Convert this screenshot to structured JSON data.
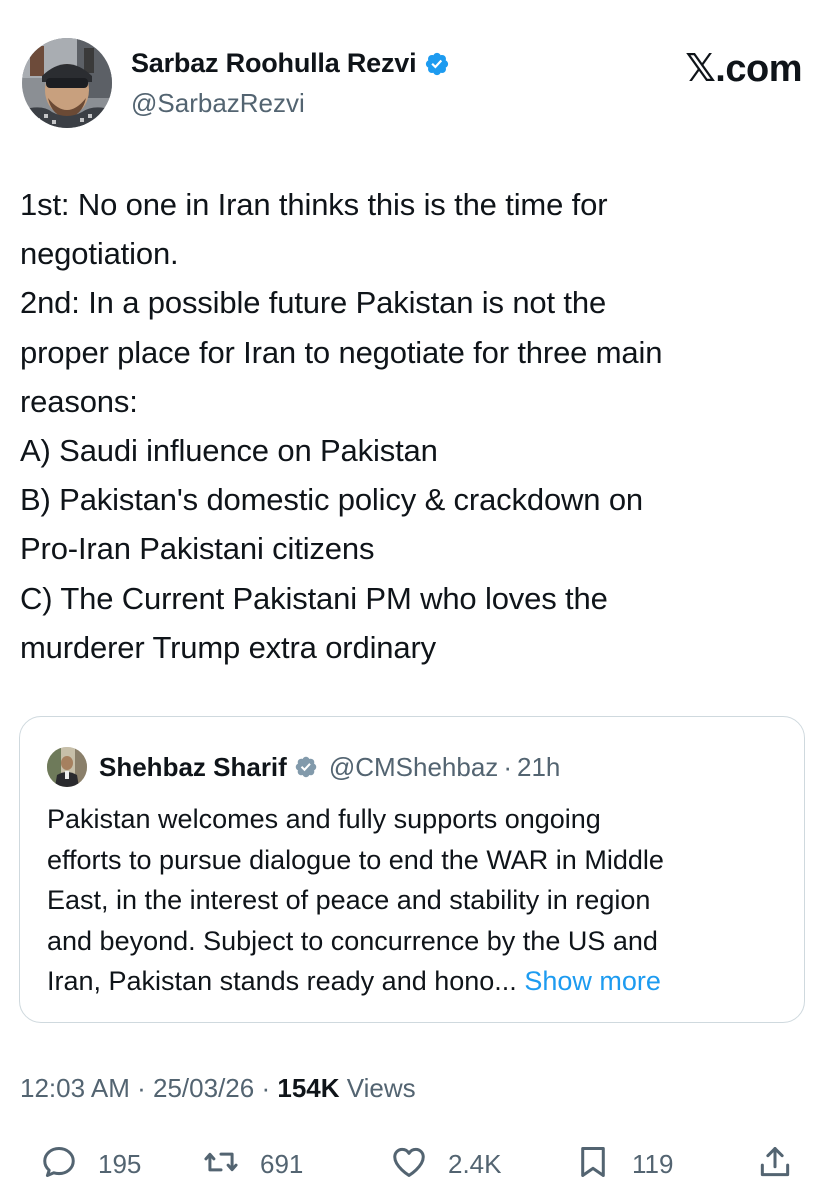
{
  "author": {
    "display_name": "Sarbaz Roohulla Rezvi",
    "handle": "@SarbazRezvi"
  },
  "brand": "𝕏.com",
  "tweet": {
    "lines": [
      "1st: No one in Iran thinks this is the time for",
      "negotiation.",
      "2nd: In a possible future Pakistan is not the",
      "proper place for Iran to negotiate for three main",
      "reasons:",
      "A) Saudi influence on Pakistan",
      "B) Pakistan's domestic policy & crackdown on",
      "Pro-Iran Pakistani citizens",
      "C) The Current Pakistani PM who loves the",
      "murderer Trump extra ordinary"
    ]
  },
  "quoted": {
    "display_name": "Shehbaz Sharif",
    "handle": "@CMShehbaz",
    "dot": "·",
    "time": "21h",
    "lines": [
      "Pakistan welcomes and fully supports ongoing",
      "efforts to pursue dialogue to end the WAR in Middle",
      "East, in the interest of peace and stability in region",
      "and beyond. Subject to concurrence by the US and"
    ],
    "last_line": "Iran, Pakistan stands ready and hono...",
    "show_more": "Show more"
  },
  "meta": {
    "time": "12:03 AM",
    "sep1": "·",
    "date": "25/03/26",
    "sep2": "·",
    "views_count": "154K",
    "views_label": "Views"
  },
  "actions": {
    "replies": "195",
    "reposts": "691",
    "likes": "2.4K",
    "bookmarks": "119"
  },
  "colors": {
    "text": "#0f1419",
    "secondary": "#536471",
    "link": "#1d9bf0",
    "verified": "#1d9bf0",
    "border": "#cfd9de"
  }
}
